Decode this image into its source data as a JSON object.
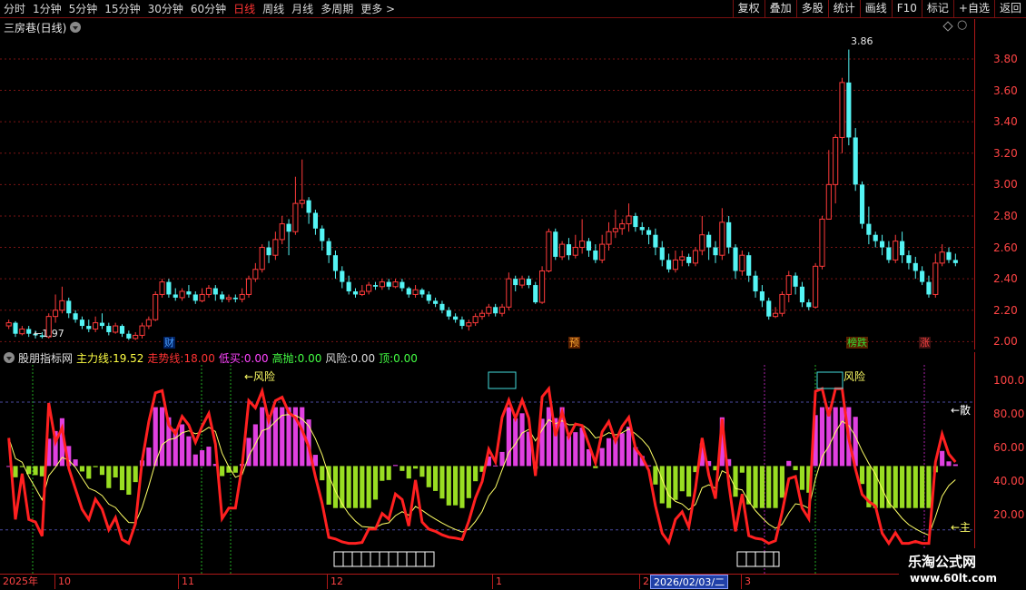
{
  "toolbar": {
    "periods": [
      "分时",
      "1分钟",
      "5分钟",
      "15分钟",
      "30分钟",
      "60分钟",
      "日线",
      "周线",
      "月线",
      "多周期",
      "更多 >"
    ],
    "active_period": "日线",
    "tools": [
      "复权",
      "叠加",
      "多股",
      "统计",
      "画线",
      "F10",
      "标记",
      "+自选",
      "返回"
    ]
  },
  "main_chart": {
    "stock_name": "三房巷(日线)",
    "price_axis_labels": [
      "3.80",
      "3.60",
      "3.40",
      "3.20",
      "3.00",
      "2.80",
      "2.60",
      "2.40",
      "2.20",
      "2.00"
    ],
    "high_label": "3.86",
    "low_label": "←1.97",
    "markers": [
      {
        "text": "财",
        "color": "#4aa0ff"
      },
      {
        "text": "预",
        "color": "#ffaa33"
      },
      {
        "text": "榜跌",
        "color": "#33dd33"
      },
      {
        "text": "涨",
        "color": "#ff4444"
      }
    ]
  },
  "indicator": {
    "name": "股朋指标网",
    "legend": [
      {
        "label": "主力线:",
        "value": "19.52",
        "color": "#ffff44"
      },
      {
        "label": "走势线:",
        "value": "18.00",
        "color": "#ff3333"
      },
      {
        "label": "低买:",
        "value": "0.00",
        "color": "#ff44ff"
      },
      {
        "label": "高抛:",
        "value": "0.00",
        "color": "#44ff44"
      },
      {
        "label": "风险:",
        "value": "0.00",
        "color": "#dddddd"
      },
      {
        "label": "顶:",
        "value": "0.00",
        "color": "#44ff44"
      }
    ],
    "axis_labels": [
      "100.0",
      "80.00",
      "60.00",
      "40.00",
      "20.00"
    ],
    "annotations": {
      "risk1": "←风险",
      "risk2": "风险",
      "scatter": "←散",
      "main": "←主"
    }
  },
  "date_axis": {
    "ticks": [
      "2025年",
      "10",
      "11",
      "12",
      "1",
      "2",
      "3"
    ],
    "cursor_date": "2026/02/03/二"
  },
  "watermark": {
    "title": "乐淘公式网",
    "url": "www.60lt.com"
  },
  "colors": {
    "up": "#ff3b3b",
    "down": "#54f4f4",
    "grid": "#7a1414",
    "main_line": "#ffff66",
    "trend_line": "#ff2020",
    "pos_bar": "#e040e0",
    "neg_bar": "#99dd22"
  },
  "chart_data": {
    "type": "candlestick",
    "price_range": [
      1.95,
      3.95
    ],
    "candles": [
      [
        2.1,
        2.12,
        2.08,
        2.14
      ],
      [
        2.12,
        2.05,
        2.03,
        2.13
      ],
      [
        2.05,
        2.08,
        2.04,
        2.1
      ],
      [
        2.08,
        2.05,
        2.03,
        2.1
      ],
      [
        2.05,
        2.04,
        2.02,
        2.07
      ],
      [
        2.04,
        2.03,
        2.02,
        2.06
      ],
      [
        2.03,
        2.16,
        2.02,
        2.18
      ],
      [
        2.16,
        2.2,
        2.12,
        2.3
      ],
      [
        2.2,
        2.26,
        2.18,
        2.35
      ],
      [
        2.26,
        2.18,
        2.15,
        2.28
      ],
      [
        2.18,
        2.14,
        2.12,
        2.2
      ],
      [
        2.14,
        2.1,
        2.08,
        2.16
      ],
      [
        2.1,
        2.08,
        2.06,
        2.14
      ],
      [
        2.08,
        2.12,
        2.06,
        2.16
      ],
      [
        2.12,
        2.1,
        2.08,
        2.18
      ],
      [
        2.1,
        2.06,
        2.04,
        2.12
      ],
      [
        2.06,
        2.1,
        2.05,
        2.12
      ],
      [
        2.1,
        2.05,
        2.03,
        2.11
      ],
      [
        2.05,
        2.02,
        2.01,
        2.07
      ],
      [
        2.02,
        2.04,
        2.01,
        2.06
      ],
      [
        2.04,
        2.1,
        2.02,
        2.12
      ],
      [
        2.1,
        2.14,
        2.08,
        2.16
      ],
      [
        2.14,
        2.3,
        2.13,
        2.32
      ],
      [
        2.3,
        2.38,
        2.28,
        2.4
      ],
      [
        2.38,
        2.3,
        2.28,
        2.4
      ],
      [
        2.3,
        2.28,
        2.26,
        2.34
      ],
      [
        2.28,
        2.32,
        2.26,
        2.34
      ],
      [
        2.32,
        2.3,
        2.28,
        2.36
      ],
      [
        2.3,
        2.26,
        2.24,
        2.32
      ],
      [
        2.26,
        2.3,
        2.25,
        2.34
      ],
      [
        2.3,
        2.34,
        2.28,
        2.36
      ],
      [
        2.34,
        2.3,
        2.26,
        2.36
      ],
      [
        2.3,
        2.27,
        2.25,
        2.32
      ],
      [
        2.27,
        2.28,
        2.25,
        2.3
      ],
      [
        2.28,
        2.27,
        2.25,
        2.3
      ],
      [
        2.27,
        2.3,
        2.25,
        2.34
      ],
      [
        2.3,
        2.4,
        2.28,
        2.42
      ],
      [
        2.4,
        2.46,
        2.38,
        2.5
      ],
      [
        2.46,
        2.6,
        2.44,
        2.62
      ],
      [
        2.6,
        2.55,
        2.5,
        2.64
      ],
      [
        2.55,
        2.65,
        2.52,
        2.7
      ],
      [
        2.65,
        2.75,
        2.62,
        2.8
      ],
      [
        2.75,
        2.7,
        2.55,
        2.78
      ],
      [
        2.7,
        2.88,
        2.68,
        3.05
      ],
      [
        2.88,
        2.9,
        2.85,
        3.16
      ],
      [
        2.9,
        2.82,
        2.75,
        2.92
      ],
      [
        2.82,
        2.72,
        2.68,
        2.84
      ],
      [
        2.72,
        2.64,
        2.58,
        2.74
      ],
      [
        2.64,
        2.55,
        2.5,
        2.66
      ],
      [
        2.55,
        2.45,
        2.4,
        2.58
      ],
      [
        2.45,
        2.38,
        2.34,
        2.48
      ],
      [
        2.38,
        2.32,
        2.3,
        2.42
      ],
      [
        2.32,
        2.3,
        2.28,
        2.34
      ],
      [
        2.3,
        2.32,
        2.29,
        2.36
      ],
      [
        2.32,
        2.36,
        2.3,
        2.38
      ],
      [
        2.36,
        2.35,
        2.33,
        2.38
      ],
      [
        2.35,
        2.38,
        2.33,
        2.4
      ],
      [
        2.38,
        2.35,
        2.33,
        2.4
      ],
      [
        2.35,
        2.38,
        2.34,
        2.4
      ],
      [
        2.38,
        2.34,
        2.32,
        2.4
      ],
      [
        2.34,
        2.3,
        2.28,
        2.35
      ],
      [
        2.3,
        2.33,
        2.28,
        2.36
      ],
      [
        2.33,
        2.3,
        2.28,
        2.34
      ],
      [
        2.3,
        2.26,
        2.24,
        2.32
      ],
      [
        2.26,
        2.24,
        2.22,
        2.28
      ],
      [
        2.24,
        2.2,
        2.18,
        2.26
      ],
      [
        2.2,
        2.16,
        2.14,
        2.22
      ],
      [
        2.16,
        2.14,
        2.12,
        2.18
      ],
      [
        2.14,
        2.1,
        2.08,
        2.16
      ],
      [
        2.1,
        2.12,
        2.07,
        2.14
      ],
      [
        2.12,
        2.16,
        2.1,
        2.18
      ],
      [
        2.16,
        2.18,
        2.14,
        2.2
      ],
      [
        2.18,
        2.22,
        2.16,
        2.24
      ],
      [
        2.22,
        2.18,
        2.16,
        2.24
      ],
      [
        2.18,
        2.22,
        2.16,
        2.24
      ],
      [
        2.22,
        2.4,
        2.2,
        2.44
      ],
      [
        2.4,
        2.36,
        2.32,
        2.42
      ],
      [
        2.36,
        2.4,
        2.34,
        2.42
      ],
      [
        2.4,
        2.36,
        2.34,
        2.42
      ],
      [
        2.36,
        2.25,
        2.24,
        2.38
      ],
      [
        2.25,
        2.45,
        2.24,
        2.48
      ],
      [
        2.45,
        2.7,
        2.44,
        2.72
      ],
      [
        2.7,
        2.54,
        2.52,
        2.72
      ],
      [
        2.54,
        2.62,
        2.52,
        2.64
      ],
      [
        2.62,
        2.55,
        2.52,
        2.66
      ],
      [
        2.55,
        2.6,
        2.53,
        2.68
      ],
      [
        2.6,
        2.64,
        2.56,
        2.78
      ],
      [
        2.64,
        2.58,
        2.54,
        2.66
      ],
      [
        2.58,
        2.52,
        2.5,
        2.62
      ],
      [
        2.52,
        2.62,
        2.5,
        2.68
      ],
      [
        2.62,
        2.7,
        2.58,
        2.76
      ],
      [
        2.7,
        2.72,
        2.66,
        2.84
      ],
      [
        2.72,
        2.75,
        2.68,
        2.78
      ],
      [
        2.75,
        2.8,
        2.7,
        2.88
      ],
      [
        2.8,
        2.73,
        2.7,
        2.82
      ],
      [
        2.73,
        2.71,
        2.68,
        2.76
      ],
      [
        2.71,
        2.68,
        2.62,
        2.73
      ],
      [
        2.68,
        2.6,
        2.55,
        2.72
      ],
      [
        2.6,
        2.52,
        2.48,
        2.64
      ],
      [
        2.52,
        2.46,
        2.44,
        2.56
      ],
      [
        2.46,
        2.52,
        2.44,
        2.58
      ],
      [
        2.52,
        2.54,
        2.48,
        2.58
      ],
      [
        2.54,
        2.5,
        2.48,
        2.56
      ],
      [
        2.5,
        2.58,
        2.48,
        2.6
      ],
      [
        2.58,
        2.68,
        2.55,
        2.8
      ],
      [
        2.68,
        2.6,
        2.52,
        2.7
      ],
      [
        2.6,
        2.55,
        2.5,
        2.64
      ],
      [
        2.55,
        2.76,
        2.52,
        2.85
      ],
      [
        2.76,
        2.6,
        2.56,
        2.8
      ],
      [
        2.6,
        2.45,
        2.4,
        2.62
      ],
      [
        2.45,
        2.55,
        2.42,
        2.58
      ],
      [
        2.55,
        2.42,
        2.38,
        2.57
      ],
      [
        2.42,
        2.32,
        2.28,
        2.45
      ],
      [
        2.32,
        2.26,
        2.22,
        2.36
      ],
      [
        2.26,
        2.16,
        2.14,
        2.28
      ],
      [
        2.16,
        2.18,
        2.15,
        2.22
      ],
      [
        2.18,
        2.3,
        2.16,
        2.32
      ],
      [
        2.3,
        2.42,
        2.25,
        2.45
      ],
      [
        2.42,
        2.35,
        2.3,
        2.44
      ],
      [
        2.35,
        2.25,
        2.22,
        2.38
      ],
      [
        2.25,
        2.22,
        2.2,
        2.27
      ],
      [
        2.22,
        2.48,
        2.21,
        2.5
      ],
      [
        2.48,
        2.78,
        2.46,
        2.8
      ],
      [
        2.78,
        3.0,
        2.85,
        3.22
      ],
      [
        3.0,
        3.3,
        2.88,
        3.32
      ],
      [
        3.3,
        3.65,
        3.2,
        3.68
      ],
      [
        3.65,
        3.3,
        3.25,
        3.86
      ],
      [
        3.3,
        3.0,
        2.96,
        3.36
      ],
      [
        3.0,
        2.75,
        2.72,
        3.02
      ],
      [
        2.75,
        2.68,
        2.62,
        2.86
      ],
      [
        2.68,
        2.64,
        2.6,
        2.7
      ],
      [
        2.64,
        2.6,
        2.55,
        2.68
      ],
      [
        2.6,
        2.52,
        2.5,
        2.64
      ],
      [
        2.52,
        2.64,
        2.5,
        2.68
      ],
      [
        2.64,
        2.55,
        2.5,
        2.7
      ],
      [
        2.55,
        2.5,
        2.46,
        2.58
      ],
      [
        2.5,
        2.45,
        2.4,
        2.54
      ],
      [
        2.45,
        2.38,
        2.36,
        2.48
      ],
      [
        2.38,
        2.3,
        2.28,
        2.42
      ],
      [
        2.3,
        2.5,
        2.28,
        2.56
      ],
      [
        2.5,
        2.57,
        2.48,
        2.62
      ],
      [
        2.57,
        2.52,
        2.5,
        2.6
      ],
      [
        2.52,
        2.5,
        2.48,
        2.56
      ]
    ]
  }
}
